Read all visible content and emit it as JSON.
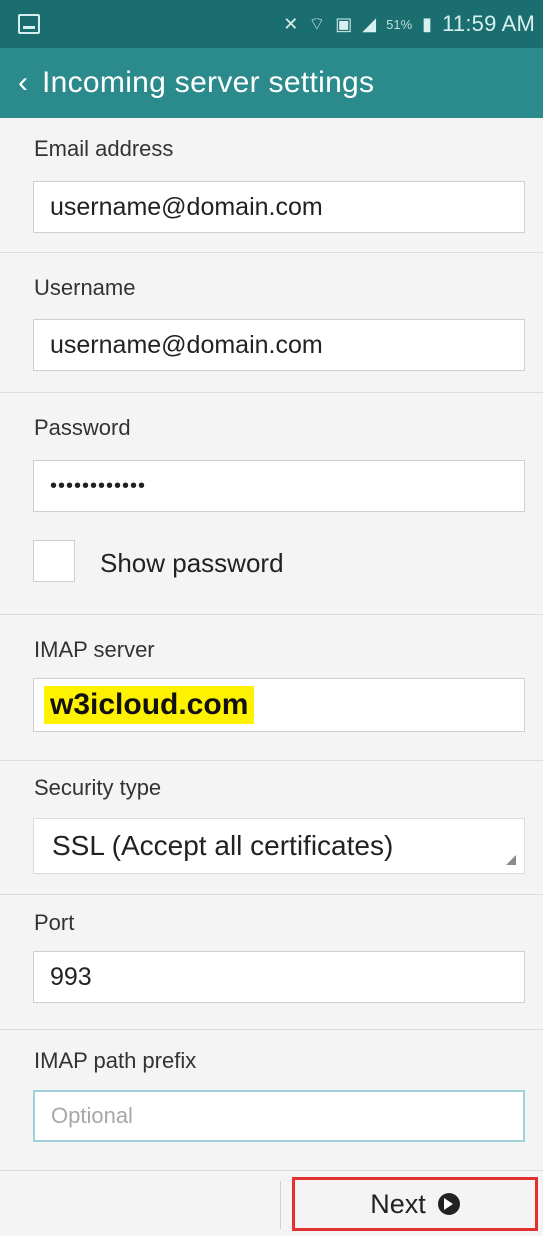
{
  "status_bar": {
    "time": "11:59 AM",
    "battery_percent": "51%",
    "icons": [
      "screenshot-icon",
      "mute-icon",
      "wifi-icon",
      "sim-icon",
      "signal-icon",
      "battery-icon"
    ]
  },
  "app_bar": {
    "back_icon": "chevron-left-icon",
    "title": "Incoming server settings"
  },
  "form": {
    "email_label": "Email address",
    "email_value": "username@domain.com",
    "username_label": "Username",
    "username_value": "username@domain.com",
    "password_label": "Password",
    "password_value": "••••••••••••",
    "show_password_label": "Show password",
    "show_password_checked": false,
    "imap_label": "IMAP server",
    "imap_value": "w3icloud.com",
    "security_label": "Security type",
    "security_value": "SSL (Accept all certificates)",
    "port_label": "Port",
    "port_value": "993",
    "prefix_label": "IMAP path prefix",
    "prefix_placeholder": "Optional"
  },
  "footer": {
    "next_label": "Next",
    "next_icon": "arrow-right-circle-icon"
  },
  "colors": {
    "status_bar": "#1b6e70",
    "app_bar": "#2a8a8c",
    "highlight": "#fff200",
    "next_border": "#e03030"
  }
}
